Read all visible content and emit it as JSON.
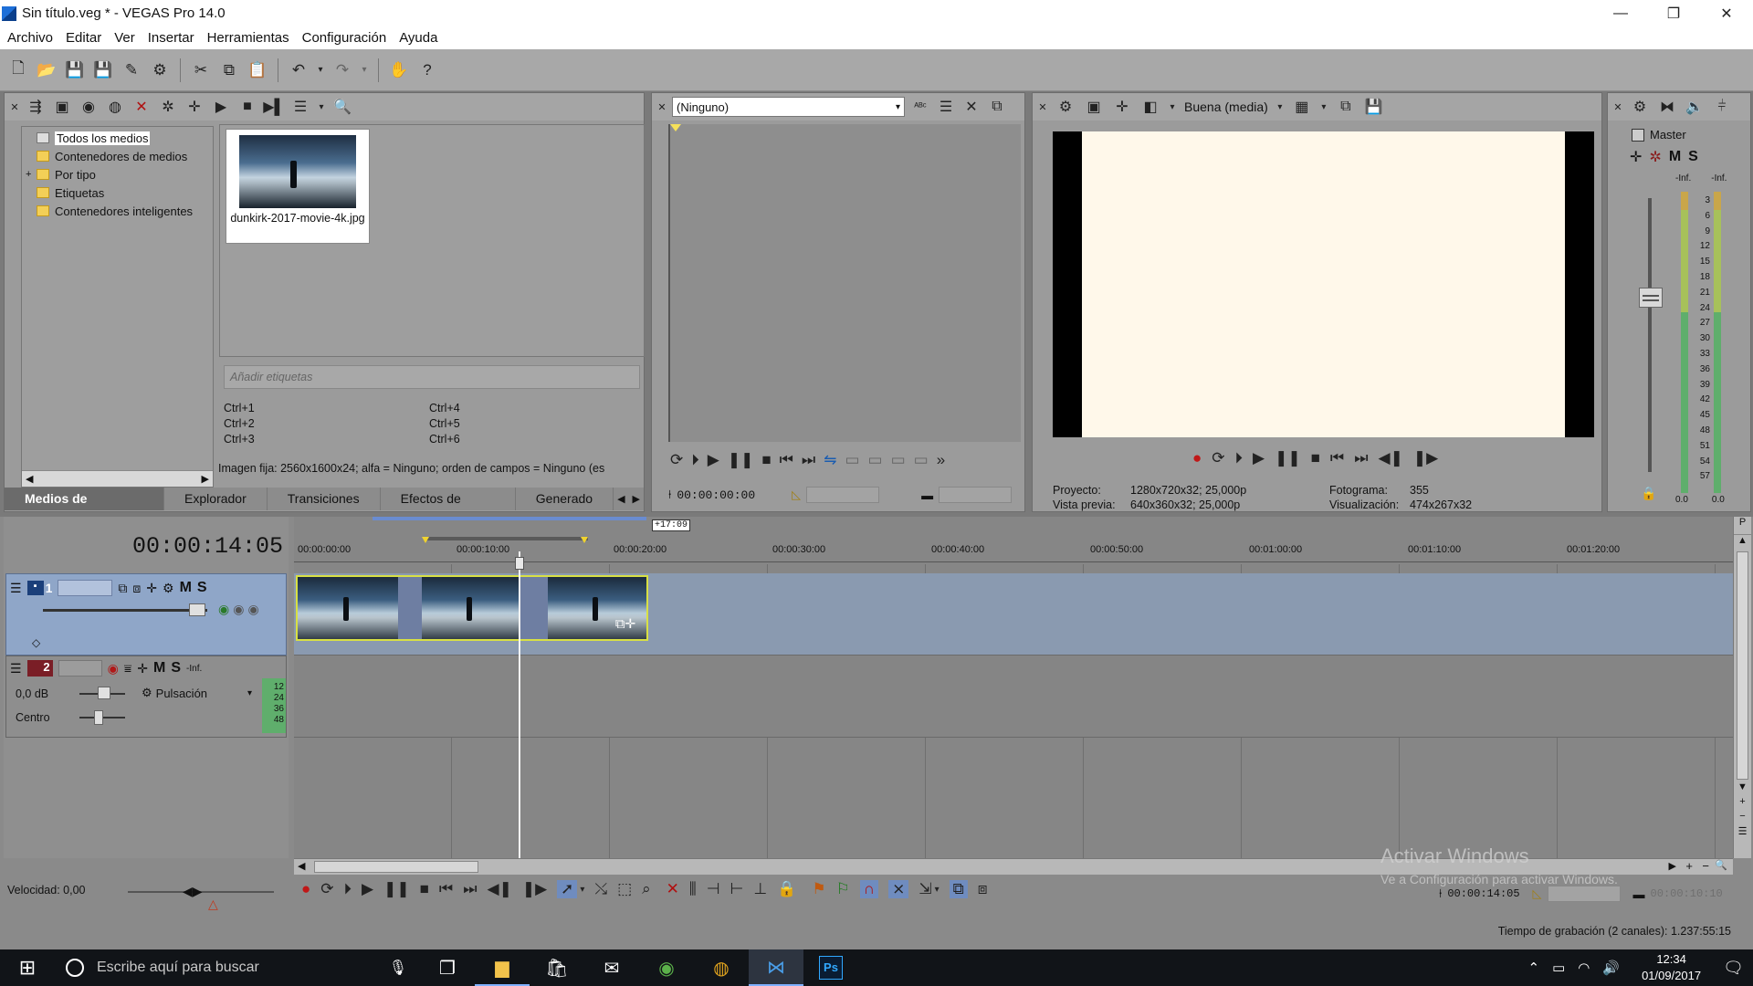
{
  "window": {
    "title": "Sin título.veg * - VEGAS Pro 14.0",
    "minimize": "—",
    "maximize": "❐",
    "close": "✕"
  },
  "menu": [
    "Archivo",
    "Editar",
    "Ver",
    "Insertar",
    "Herramientas",
    "Configuración",
    "Ayuda"
  ],
  "media_panel": {
    "tree": [
      {
        "label": "Todos los medios",
        "selected": true
      },
      {
        "label": "Contenedores de medios"
      },
      {
        "label": "Por tipo",
        "expander": "+"
      },
      {
        "label": "Etiquetas"
      },
      {
        "label": "Contenedores inteligentes"
      }
    ],
    "media_file": "dunkirk-2017-movie-4k.jpg",
    "tags_placeholder": "Añadir etiquetas",
    "shortcuts": [
      "Ctrl+1",
      "Ctrl+4",
      "Ctrl+2",
      "Ctrl+5",
      "Ctrl+3",
      "Ctrl+6"
    ],
    "status": "Imagen fija: 2560x1600x24; alfa = Ninguno; orden de campos = Ninguno (es",
    "tabs": [
      "Medios de proyecto",
      "Explorador",
      "Transiciones",
      "Efectos de vídeo",
      "Generado"
    ]
  },
  "trimmer": {
    "select_value": "(Ninguno)",
    "timecode": "00:00:00:00"
  },
  "preview": {
    "quality": "Buena (media)",
    "proyecto_label": "Proyecto:",
    "proyecto_value": "1280x720x32; 25,000p",
    "vista_label": "Vista previa:",
    "vista_value": "640x360x32; 25,000p",
    "fotograma_label": "Fotograma:",
    "fotograma_value": "355",
    "visualizacion_label": "Visualización:",
    "visualizacion_value": "474x267x32",
    "frame_color": "#fff8ea"
  },
  "master": {
    "label": "Master",
    "m": "M",
    "s": "S",
    "inf_left": "-Inf.",
    "inf_right": "-Inf.",
    "scale": [
      "3",
      "6",
      "9",
      "12",
      "15",
      "18",
      "21",
      "24",
      "27",
      "30",
      "33",
      "36",
      "39",
      "42",
      "45",
      "48",
      "51",
      "54",
      "57"
    ],
    "bottom_left": "0.0",
    "bottom_right": "0.0"
  },
  "timeline": {
    "timecode": "00:00:14:05",
    "region_badge": "+17:09",
    "ruler": [
      "00:00:00:00",
      "00:00:10:00",
      "00:00:20:00",
      "00:00:30:00",
      "00:00:40:00",
      "00:00:50:00",
      "00:01:00:00",
      "00:01:10:00",
      "00:01:20:00"
    ],
    "video_track": {
      "number": "1",
      "m": "M",
      "s": "S"
    },
    "audio_track": {
      "number": "2",
      "m": "M",
      "s": "S",
      "volume": "0,0 dB",
      "pan_label": "Centro",
      "mode": "Pulsación",
      "inf": "-Inf.",
      "meter": [
        "12",
        "24",
        "36",
        "48"
      ]
    },
    "speed": "Velocidad: 0,00",
    "cursor_time": "00:00:14:05",
    "end_time": "00:00:10:10",
    "record_time": "Tiempo de grabación (2 canales): 1.237:55:15"
  },
  "watermark": {
    "line1": "Activar Windows",
    "line2": "Ve a Configuración para activar Windows."
  },
  "taskbar": {
    "search_placeholder": "Escribe aquí para buscar",
    "time": "12:34",
    "date": "01/09/2017"
  }
}
